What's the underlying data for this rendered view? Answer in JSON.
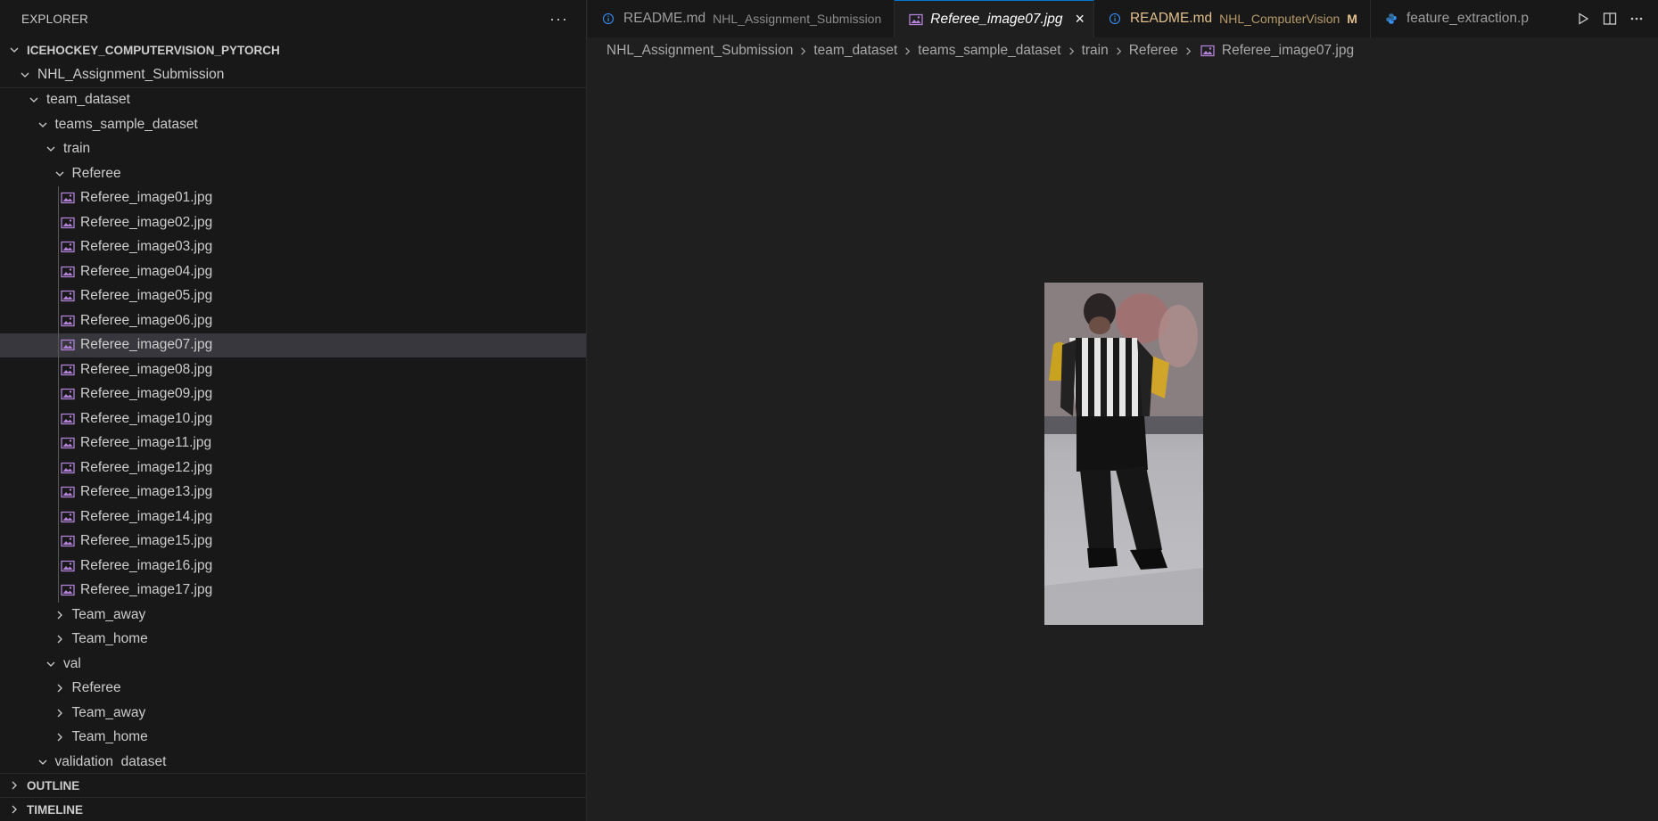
{
  "sidebar": {
    "title": "EXPLORER",
    "more_label": "···",
    "workspace": "ICEHOCKEY_COMPUTERVISION_PYTORCH",
    "sticky_folder": "NHL_Assignment_Submission",
    "tree": [
      {
        "label": "team_dataset",
        "type": "folder",
        "expanded": true
      },
      {
        "label": "teams_sample_dataset",
        "type": "folder",
        "expanded": true
      },
      {
        "label": "train",
        "type": "folder",
        "expanded": true
      },
      {
        "label": "Referee",
        "type": "folder",
        "expanded": true
      },
      {
        "label": "Referee_image01.jpg",
        "type": "image"
      },
      {
        "label": "Referee_image02.jpg",
        "type": "image"
      },
      {
        "label": "Referee_image03.jpg",
        "type": "image"
      },
      {
        "label": "Referee_image04.jpg",
        "type": "image"
      },
      {
        "label": "Referee_image05.jpg",
        "type": "image"
      },
      {
        "label": "Referee_image06.jpg",
        "type": "image"
      },
      {
        "label": "Referee_image07.jpg",
        "type": "image",
        "selected": true
      },
      {
        "label": "Referee_image08.jpg",
        "type": "image"
      },
      {
        "label": "Referee_image09.jpg",
        "type": "image"
      },
      {
        "label": "Referee_image10.jpg",
        "type": "image"
      },
      {
        "label": "Referee_image11.jpg",
        "type": "image"
      },
      {
        "label": "Referee_image12.jpg",
        "type": "image"
      },
      {
        "label": "Referee_image13.jpg",
        "type": "image"
      },
      {
        "label": "Referee_image14.jpg",
        "type": "image"
      },
      {
        "label": "Referee_image15.jpg",
        "type": "image"
      },
      {
        "label": "Referee_image16.jpg",
        "type": "image"
      },
      {
        "label": "Referee_image17.jpg",
        "type": "image"
      },
      {
        "label": "Team_away",
        "type": "folder",
        "expanded": false
      },
      {
        "label": "Team_home",
        "type": "folder",
        "expanded": false
      },
      {
        "label": "val",
        "type": "folder",
        "expanded": true
      },
      {
        "label": "Referee",
        "type": "folder",
        "expanded": false
      },
      {
        "label": "Team_away",
        "type": "folder",
        "expanded": false
      },
      {
        "label": "Team_home",
        "type": "folder",
        "expanded": false
      },
      {
        "label": "validation_dataset",
        "type": "folder",
        "expanded": true
      }
    ],
    "outline_label": "OUTLINE",
    "timeline_label": "TIMELINE"
  },
  "tabs": [
    {
      "name": "README.md",
      "desc": "NHL_Assignment_Submission",
      "icon": "info-icon",
      "active": false
    },
    {
      "name": "Referee_image07.jpg",
      "desc": "",
      "icon": "image-file-icon",
      "active": true
    },
    {
      "name": "README.md",
      "desc": "NHL_ComputerVision",
      "icon": "info-icon",
      "active": false,
      "modified_flag": "M"
    },
    {
      "name": "feature_extraction.p",
      "desc": "",
      "icon": "python-icon",
      "active": false
    }
  ],
  "breadcrumb": [
    "NHL_Assignment_Submission",
    "team_dataset",
    "teams_sample_dataset",
    "train",
    "Referee",
    "Referee_image07.jpg"
  ],
  "colors": {
    "accent": "#0078d4",
    "image_icon": "#b180d7",
    "info_icon": "#3794ff",
    "modified": "#e2c08d",
    "selection": "#37373d"
  }
}
